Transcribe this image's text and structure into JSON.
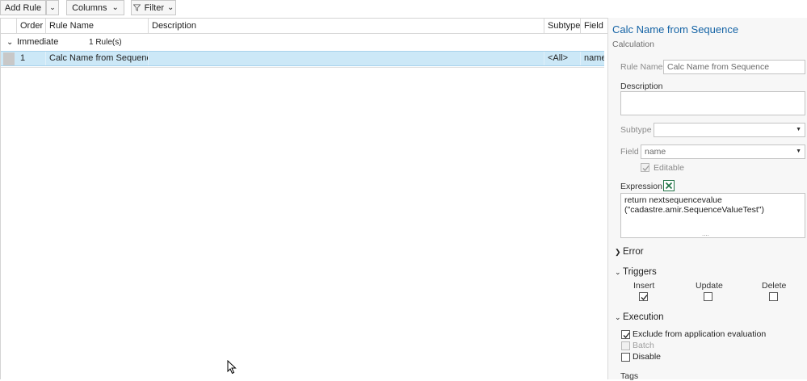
{
  "toolbar": {
    "add_rule": "Add Rule",
    "columns": "Columns",
    "filter": "Filter"
  },
  "grid": {
    "headers": [
      "Order",
      "Rule Name",
      "Description",
      "Subtype",
      "Field"
    ],
    "group": {
      "name": "Immediate",
      "count": "1 Rule(s)"
    },
    "rows": [
      {
        "order": "1",
        "rule_name": "Calc Name from Sequence",
        "description": "",
        "subtype": "<All>",
        "field": "name"
      }
    ]
  },
  "panel": {
    "title": "Calc Name from Sequence",
    "subtitle": "Calculation",
    "rule_name_label": "Rule Name",
    "rule_name_value": "Calc Name from Sequence",
    "description_label": "Description",
    "description_value": "",
    "subtype_label": "Subtype",
    "subtype_value": "",
    "field_label": "Field",
    "field_value": "name",
    "editable_label": "Editable",
    "editable_checked": true,
    "expression_label": "Expression",
    "expression_line1": "return nextsequencevalue",
    "expression_line2": "(\"cadastre.amir.SequenceValueTest\")",
    "expression_more": "....",
    "error_section": "Error",
    "triggers_section": "Triggers",
    "triggers": [
      {
        "label": "Insert",
        "checked": true
      },
      {
        "label": "Update",
        "checked": false
      },
      {
        "label": "Delete",
        "checked": false
      }
    ],
    "execution_section": "Execution",
    "execution": [
      {
        "label": "Exclude from application evaluation",
        "checked": true,
        "enabled": true
      },
      {
        "label": "Batch",
        "checked": false,
        "enabled": false
      },
      {
        "label": "Disable",
        "checked": false,
        "enabled": true
      }
    ],
    "tags_label": "Tags"
  },
  "colors": {
    "accent": "#1463a5",
    "row_selected": "#cce8f7",
    "excel_green": "#217346"
  }
}
